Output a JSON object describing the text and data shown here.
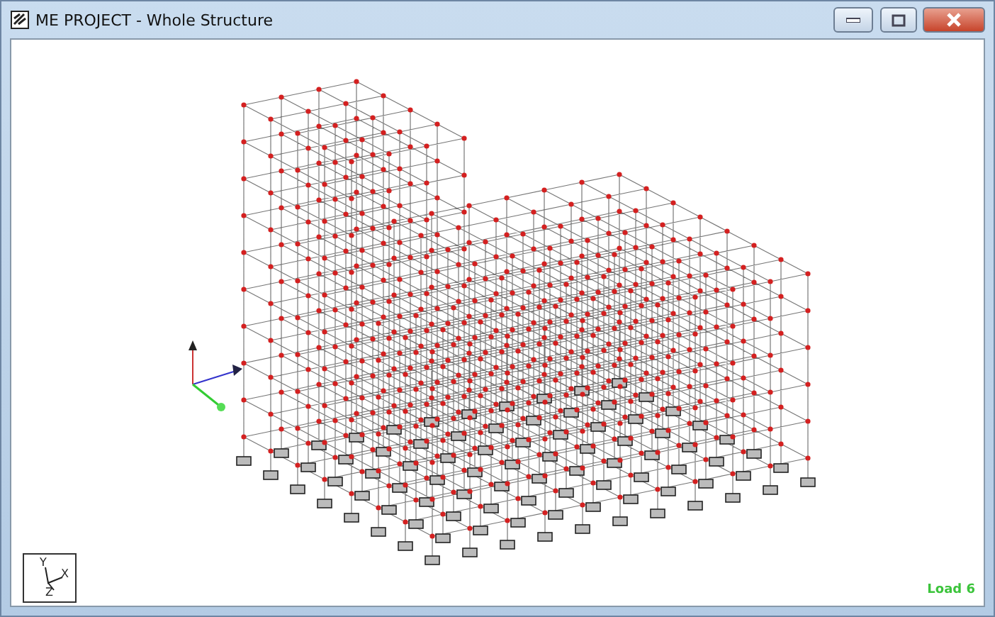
{
  "window": {
    "title": "ME PROJECT - Whole Structure"
  },
  "viewport": {
    "axis_labels": [
      "Y",
      "X",
      "Z"
    ],
    "load_label": "Load 6"
  }
}
